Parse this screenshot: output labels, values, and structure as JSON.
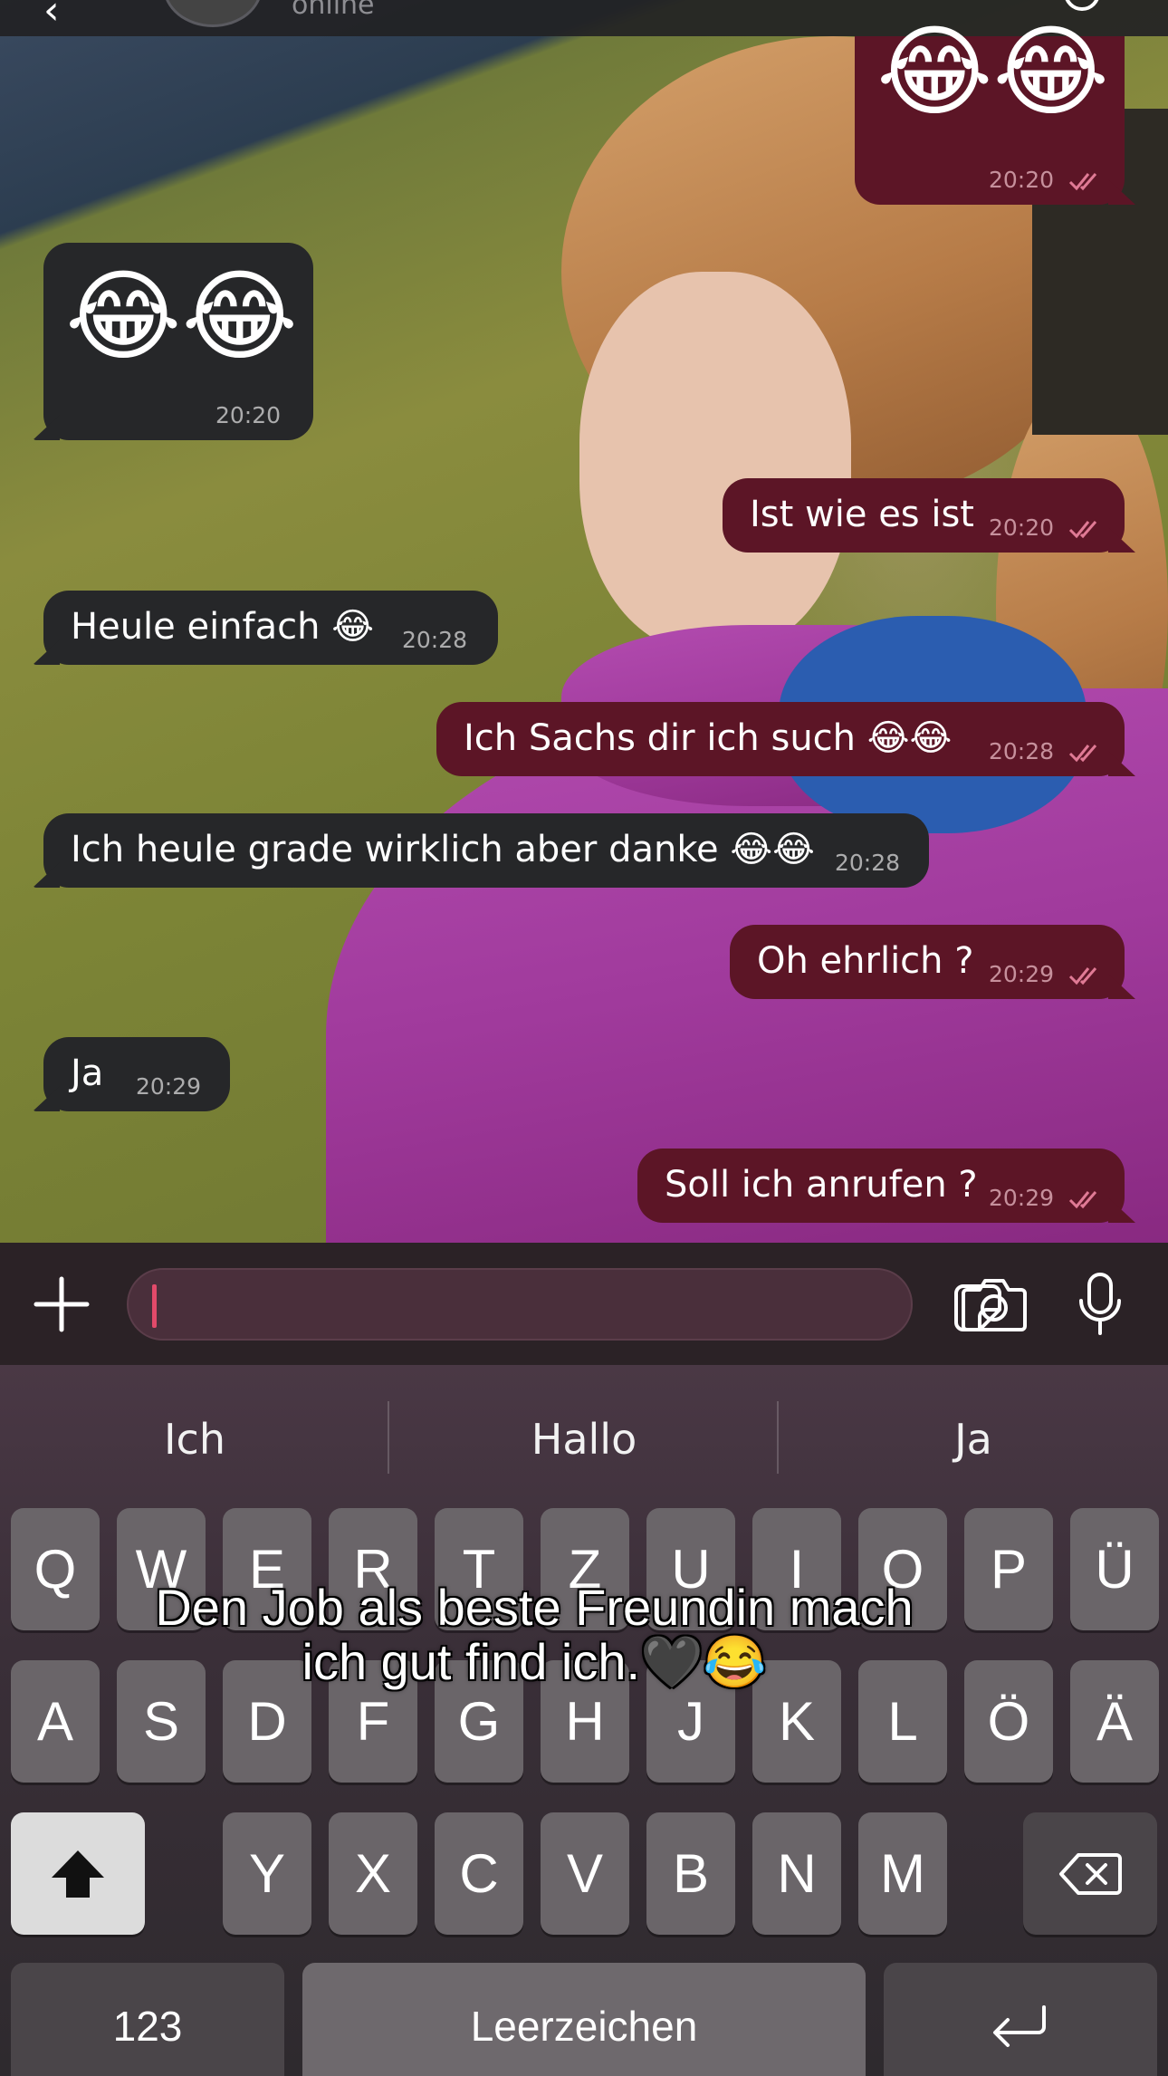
{
  "header": {
    "back_icon": "chevron-left-icon",
    "status": "online"
  },
  "messages": [
    {
      "dir": "out",
      "text": "😂😂",
      "time": "20:20",
      "read": true
    },
    {
      "dir": "in",
      "text": "😂😂",
      "time": "20:20"
    },
    {
      "dir": "out",
      "text": "Ist wie es ist",
      "time": "20:20",
      "read": true
    },
    {
      "dir": "in",
      "text": "Heule einfach 😂",
      "time": "20:28"
    },
    {
      "dir": "out",
      "text": "Ich Sachs dir ich such 😂😂",
      "time": "20:28",
      "read": true
    },
    {
      "dir": "in",
      "text": "Ich heule grade wirklich aber danke 😂😂",
      "time": "20:28"
    },
    {
      "dir": "out",
      "text": "Oh ehrlich ?",
      "time": "20:29",
      "read": true
    },
    {
      "dir": "in",
      "text": "Ja",
      "time": "20:29"
    },
    {
      "dir": "out",
      "text": "Soll ich anrufen ?",
      "time": "20:29",
      "read": true
    }
  ],
  "input": {
    "value": "",
    "icons": [
      "plus-icon",
      "sticker-icon",
      "camera-icon",
      "microphone-icon"
    ]
  },
  "keyboard": {
    "suggestions": [
      "Ich",
      "Hallo",
      "Ja"
    ],
    "row1": [
      "Q",
      "W",
      "E",
      "R",
      "T",
      "Z",
      "U",
      "I",
      "O",
      "P",
      "Ü"
    ],
    "row2": [
      "A",
      "S",
      "D",
      "F",
      "G",
      "H",
      "J",
      "K",
      "L",
      "Ö",
      "Ä"
    ],
    "row3": [
      "Y",
      "X",
      "C",
      "V",
      "B",
      "N",
      "M"
    ],
    "num_label": "123",
    "space_label": "Leerzeichen"
  },
  "caption": {
    "line1": "Den Job als beste Freundin mach",
    "line2": "ich gut find ich.🖤😂"
  },
  "colors": {
    "outgoing_bubble": "#5c1526",
    "incoming_bubble": "#262729",
    "read_ticks": "#e07a95"
  }
}
